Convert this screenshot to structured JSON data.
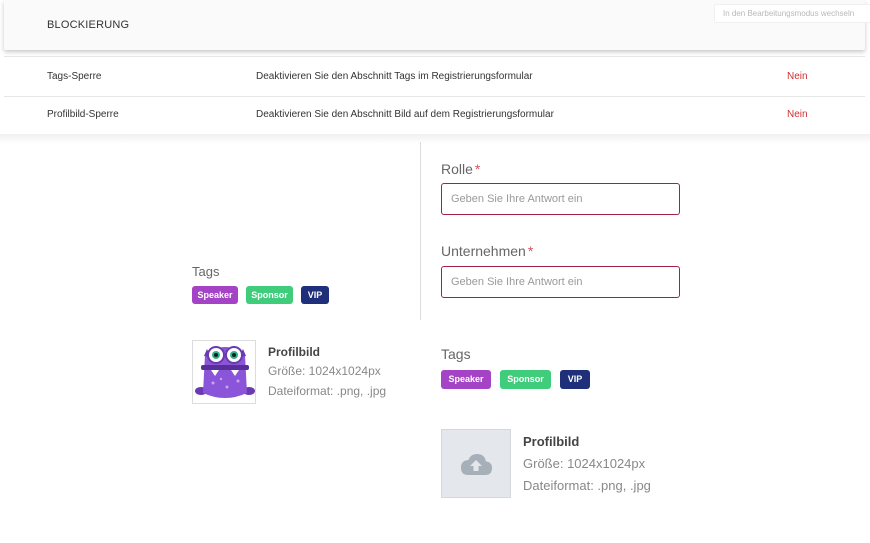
{
  "section": {
    "title": "BLOCKIERUNG",
    "edit_mode_label": "In den Bearbeitungsmodus wechseln"
  },
  "settings": [
    {
      "name": "Tags-Sperre",
      "description": "Deaktivieren Sie den Abschnitt Tags im Registrierungsformular",
      "value": "Nein"
    },
    {
      "name": "Profilbild-Sperre",
      "description": "Deaktivieren Sie den Abschnitt Bild auf dem Registrierungsformular",
      "value": "Nein"
    }
  ],
  "preview_left": {
    "tags_label": "Tags",
    "tags": [
      "Speaker",
      "Sponsor",
      "VIP"
    ],
    "profile_image": {
      "title": "Profilbild",
      "size": "Größe: 1024x1024px",
      "format": "Dateiformat: .png, .jpg"
    }
  },
  "preview_right": {
    "fields": [
      {
        "label": "Rolle",
        "required_mark": "*",
        "placeholder": "Geben Sie Ihre Antwort ein",
        "value": ""
      },
      {
        "label": "Unternehmen",
        "required_mark": "*",
        "placeholder": "Geben Sie Ihre Antwort ein",
        "value": ""
      }
    ],
    "tags_label": "Tags",
    "tags": [
      "Speaker",
      "Sponsor",
      "VIP"
    ],
    "profile_image": {
      "title": "Profilbild",
      "size": "Größe: 1024x1024px",
      "format": "Dateiformat: .png, .jpg"
    }
  },
  "colors": {
    "tag_speaker": "#a443c6",
    "tag_sponsor": "#3fcd7c",
    "tag_vip": "#1f2f7a",
    "value_no": "#d0302f",
    "input_border": "#a32145"
  },
  "icons": {
    "avatar": "purple-monster-avatar-icon",
    "upload": "cloud-upload-icon"
  }
}
